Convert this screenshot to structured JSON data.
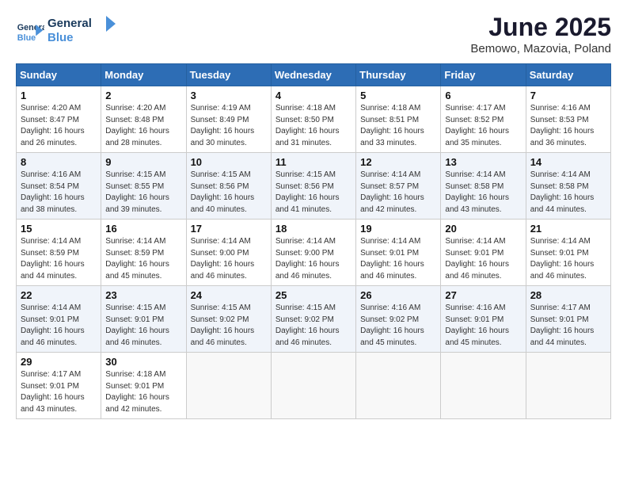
{
  "logo": {
    "line1": "General",
    "line2": "Blue"
  },
  "title": "June 2025",
  "subtitle": "Bemowo, Mazovia, Poland",
  "weekdays": [
    "Sunday",
    "Monday",
    "Tuesday",
    "Wednesday",
    "Thursday",
    "Friday",
    "Saturday"
  ],
  "weeks": [
    [
      {
        "day": "1",
        "info": "Sunrise: 4:20 AM\nSunset: 8:47 PM\nDaylight: 16 hours\nand 26 minutes."
      },
      {
        "day": "2",
        "info": "Sunrise: 4:20 AM\nSunset: 8:48 PM\nDaylight: 16 hours\nand 28 minutes."
      },
      {
        "day": "3",
        "info": "Sunrise: 4:19 AM\nSunset: 8:49 PM\nDaylight: 16 hours\nand 30 minutes."
      },
      {
        "day": "4",
        "info": "Sunrise: 4:18 AM\nSunset: 8:50 PM\nDaylight: 16 hours\nand 31 minutes."
      },
      {
        "day": "5",
        "info": "Sunrise: 4:18 AM\nSunset: 8:51 PM\nDaylight: 16 hours\nand 33 minutes."
      },
      {
        "day": "6",
        "info": "Sunrise: 4:17 AM\nSunset: 8:52 PM\nDaylight: 16 hours\nand 35 minutes."
      },
      {
        "day": "7",
        "info": "Sunrise: 4:16 AM\nSunset: 8:53 PM\nDaylight: 16 hours\nand 36 minutes."
      }
    ],
    [
      {
        "day": "8",
        "info": "Sunrise: 4:16 AM\nSunset: 8:54 PM\nDaylight: 16 hours\nand 38 minutes."
      },
      {
        "day": "9",
        "info": "Sunrise: 4:15 AM\nSunset: 8:55 PM\nDaylight: 16 hours\nand 39 minutes."
      },
      {
        "day": "10",
        "info": "Sunrise: 4:15 AM\nSunset: 8:56 PM\nDaylight: 16 hours\nand 40 minutes."
      },
      {
        "day": "11",
        "info": "Sunrise: 4:15 AM\nSunset: 8:56 PM\nDaylight: 16 hours\nand 41 minutes."
      },
      {
        "day": "12",
        "info": "Sunrise: 4:14 AM\nSunset: 8:57 PM\nDaylight: 16 hours\nand 42 minutes."
      },
      {
        "day": "13",
        "info": "Sunrise: 4:14 AM\nSunset: 8:58 PM\nDaylight: 16 hours\nand 43 minutes."
      },
      {
        "day": "14",
        "info": "Sunrise: 4:14 AM\nSunset: 8:58 PM\nDaylight: 16 hours\nand 44 minutes."
      }
    ],
    [
      {
        "day": "15",
        "info": "Sunrise: 4:14 AM\nSunset: 8:59 PM\nDaylight: 16 hours\nand 44 minutes."
      },
      {
        "day": "16",
        "info": "Sunrise: 4:14 AM\nSunset: 8:59 PM\nDaylight: 16 hours\nand 45 minutes."
      },
      {
        "day": "17",
        "info": "Sunrise: 4:14 AM\nSunset: 9:00 PM\nDaylight: 16 hours\nand 46 minutes."
      },
      {
        "day": "18",
        "info": "Sunrise: 4:14 AM\nSunset: 9:00 PM\nDaylight: 16 hours\nand 46 minutes."
      },
      {
        "day": "19",
        "info": "Sunrise: 4:14 AM\nSunset: 9:01 PM\nDaylight: 16 hours\nand 46 minutes."
      },
      {
        "day": "20",
        "info": "Sunrise: 4:14 AM\nSunset: 9:01 PM\nDaylight: 16 hours\nand 46 minutes."
      },
      {
        "day": "21",
        "info": "Sunrise: 4:14 AM\nSunset: 9:01 PM\nDaylight: 16 hours\nand 46 minutes."
      }
    ],
    [
      {
        "day": "22",
        "info": "Sunrise: 4:14 AM\nSunset: 9:01 PM\nDaylight: 16 hours\nand 46 minutes."
      },
      {
        "day": "23",
        "info": "Sunrise: 4:15 AM\nSunset: 9:01 PM\nDaylight: 16 hours\nand 46 minutes."
      },
      {
        "day": "24",
        "info": "Sunrise: 4:15 AM\nSunset: 9:02 PM\nDaylight: 16 hours\nand 46 minutes."
      },
      {
        "day": "25",
        "info": "Sunrise: 4:15 AM\nSunset: 9:02 PM\nDaylight: 16 hours\nand 46 minutes."
      },
      {
        "day": "26",
        "info": "Sunrise: 4:16 AM\nSunset: 9:02 PM\nDaylight: 16 hours\nand 45 minutes."
      },
      {
        "day": "27",
        "info": "Sunrise: 4:16 AM\nSunset: 9:01 PM\nDaylight: 16 hours\nand 45 minutes."
      },
      {
        "day": "28",
        "info": "Sunrise: 4:17 AM\nSunset: 9:01 PM\nDaylight: 16 hours\nand 44 minutes."
      }
    ],
    [
      {
        "day": "29",
        "info": "Sunrise: 4:17 AM\nSunset: 9:01 PM\nDaylight: 16 hours\nand 43 minutes."
      },
      {
        "day": "30",
        "info": "Sunrise: 4:18 AM\nSunset: 9:01 PM\nDaylight: 16 hours\nand 42 minutes."
      },
      {
        "day": "",
        "info": ""
      },
      {
        "day": "",
        "info": ""
      },
      {
        "day": "",
        "info": ""
      },
      {
        "day": "",
        "info": ""
      },
      {
        "day": "",
        "info": ""
      }
    ]
  ]
}
